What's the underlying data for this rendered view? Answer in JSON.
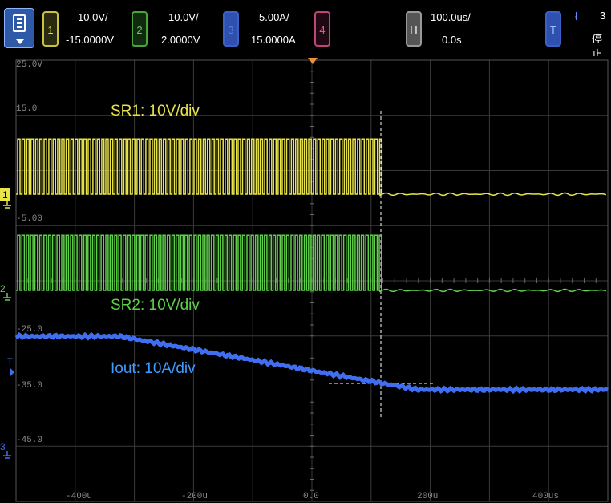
{
  "toolbar": {
    "ch1": {
      "num": "1",
      "scale": "10.0V/",
      "offset": "-15.0000V",
      "color": "#e8e44a"
    },
    "ch2": {
      "num": "2",
      "scale": "10.0V/",
      "offset": "2.0000V",
      "color": "#5fd04a"
    },
    "ch3": {
      "num": "3",
      "scale": "5.00A/",
      "offset": "15.0000A",
      "color": "#3f6ff0"
    },
    "ch4": {
      "num": "4"
    },
    "horizontal": {
      "label": "H",
      "scale": "100.0us/",
      "delay": "0.0s"
    },
    "trigger": {
      "label": "T",
      "symbol": "ł",
      "number": "3",
      "status": "停止"
    }
  },
  "graticule": {
    "level_labels": [
      "25.0V",
      "15.0",
      "-5.00",
      "-25.0",
      "-35.0",
      "-45.0"
    ],
    "time_labels": [
      "-400u",
      "-200u",
      "0.0",
      "200u",
      "400us"
    ],
    "markers": {
      "ch1": "1",
      "ch2": "2",
      "ch3": "3",
      "trigger": "T"
    }
  },
  "annotations": {
    "sr1": "SR1: 10V/div",
    "sr2": "SR2: 10V/div",
    "iout": "Iout:  10A/div"
  },
  "waveforms": {
    "sr1": {
      "high_v": 10,
      "low_v": 0,
      "switching_until_us": 115
    },
    "sr2": {
      "high_v": 10,
      "low_v": 0,
      "switching_until_us": 115
    },
    "iout": {
      "start_a": 20.2,
      "ramp_start_us": -325,
      "ramp_end_us": 180,
      "end_a": 10.5
    }
  },
  "colors": {
    "ch1": "#e8e44a",
    "ch2": "#5fd04a",
    "ch3": "#3f6ff0",
    "grid": "#3a3a3a",
    "label": "#8a8a8a"
  }
}
